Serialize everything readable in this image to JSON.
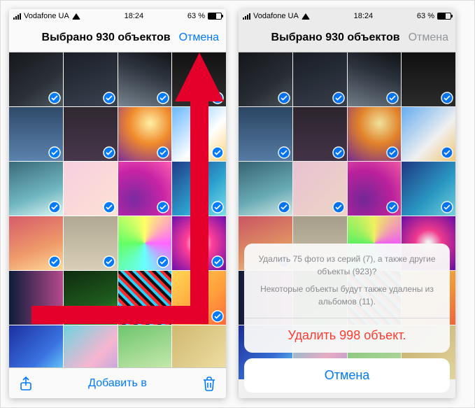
{
  "status": {
    "carrier": "Vodafone UA",
    "time": "18:24",
    "battery_text": "63 %"
  },
  "header": {
    "title": "Выбрано 930 объектов",
    "cancel": "Отмена"
  },
  "toolbar": {
    "add_to": "Добавить в"
  },
  "sheet": {
    "line1": "Удалить 75 фото из серий (7), а также другие объекты (923)?",
    "line2": "Некоторые объекты будут также удалены из альбомов (11).",
    "destructive": "Удалить 998 объект.",
    "cancel": "Отмена"
  },
  "colors": {
    "accent": "#007aff",
    "destructive": "#ff3b30",
    "arrow": "#e4002b"
  }
}
